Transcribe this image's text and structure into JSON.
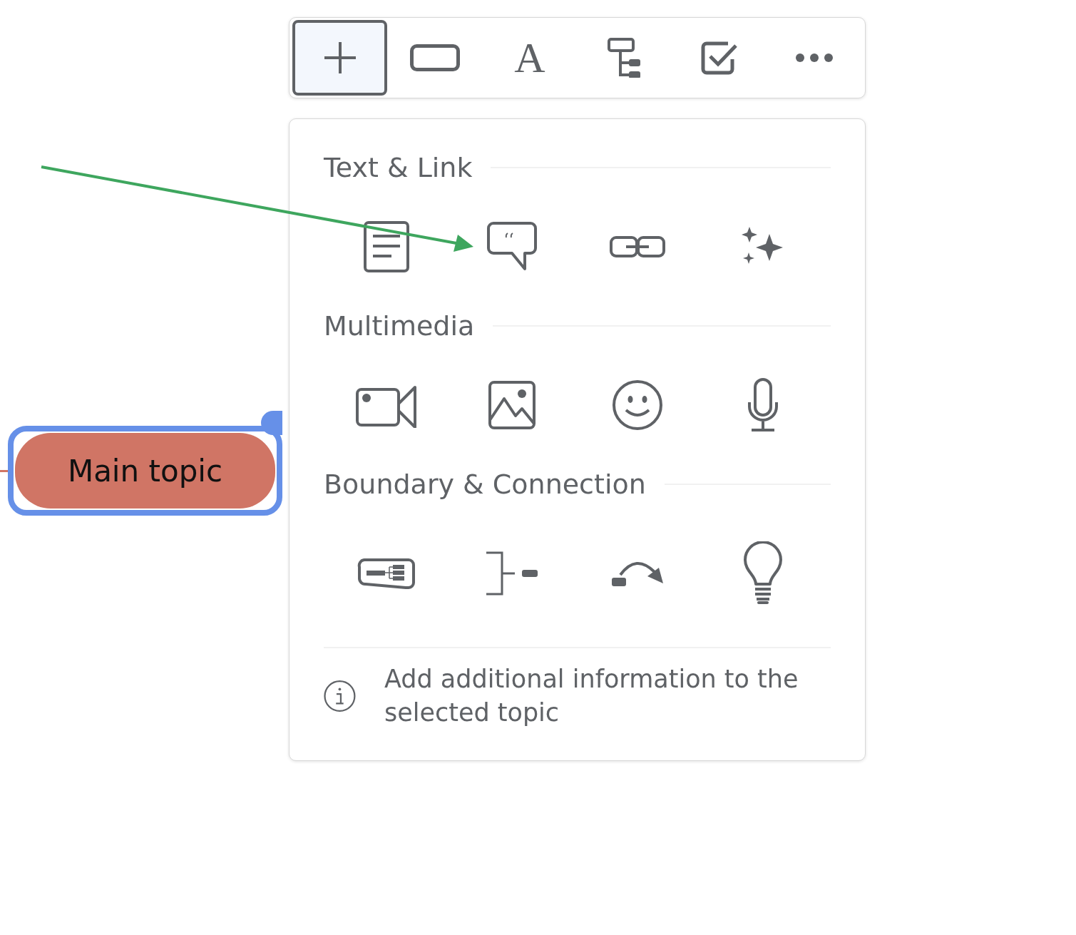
{
  "toolbar": {
    "tools": [
      {
        "kind": "add",
        "selected": true
      },
      {
        "kind": "topic",
        "selected": false
      },
      {
        "kind": "text",
        "glyph": "A",
        "selected": false
      },
      {
        "kind": "structure",
        "selected": false
      },
      {
        "kind": "task",
        "selected": false
      },
      {
        "kind": "more",
        "selected": false
      }
    ]
  },
  "insert_panel": {
    "sections": [
      {
        "title": "Text & Link",
        "items": [
          {
            "kind": "note"
          },
          {
            "kind": "comment"
          },
          {
            "kind": "link"
          },
          {
            "kind": "ai"
          }
        ]
      },
      {
        "title": "Multimedia",
        "items": [
          {
            "kind": "video"
          },
          {
            "kind": "image"
          },
          {
            "kind": "emoji"
          },
          {
            "kind": "audio"
          }
        ]
      },
      {
        "title": "Boundary & Connection",
        "items": [
          {
            "kind": "boundary"
          },
          {
            "kind": "summary"
          },
          {
            "kind": "relationship"
          },
          {
            "kind": "idea"
          }
        ]
      }
    ],
    "hint": "Add additional information to the selected topic"
  },
  "canvas": {
    "topic": {
      "label": "Main topic",
      "selected": true
    }
  }
}
